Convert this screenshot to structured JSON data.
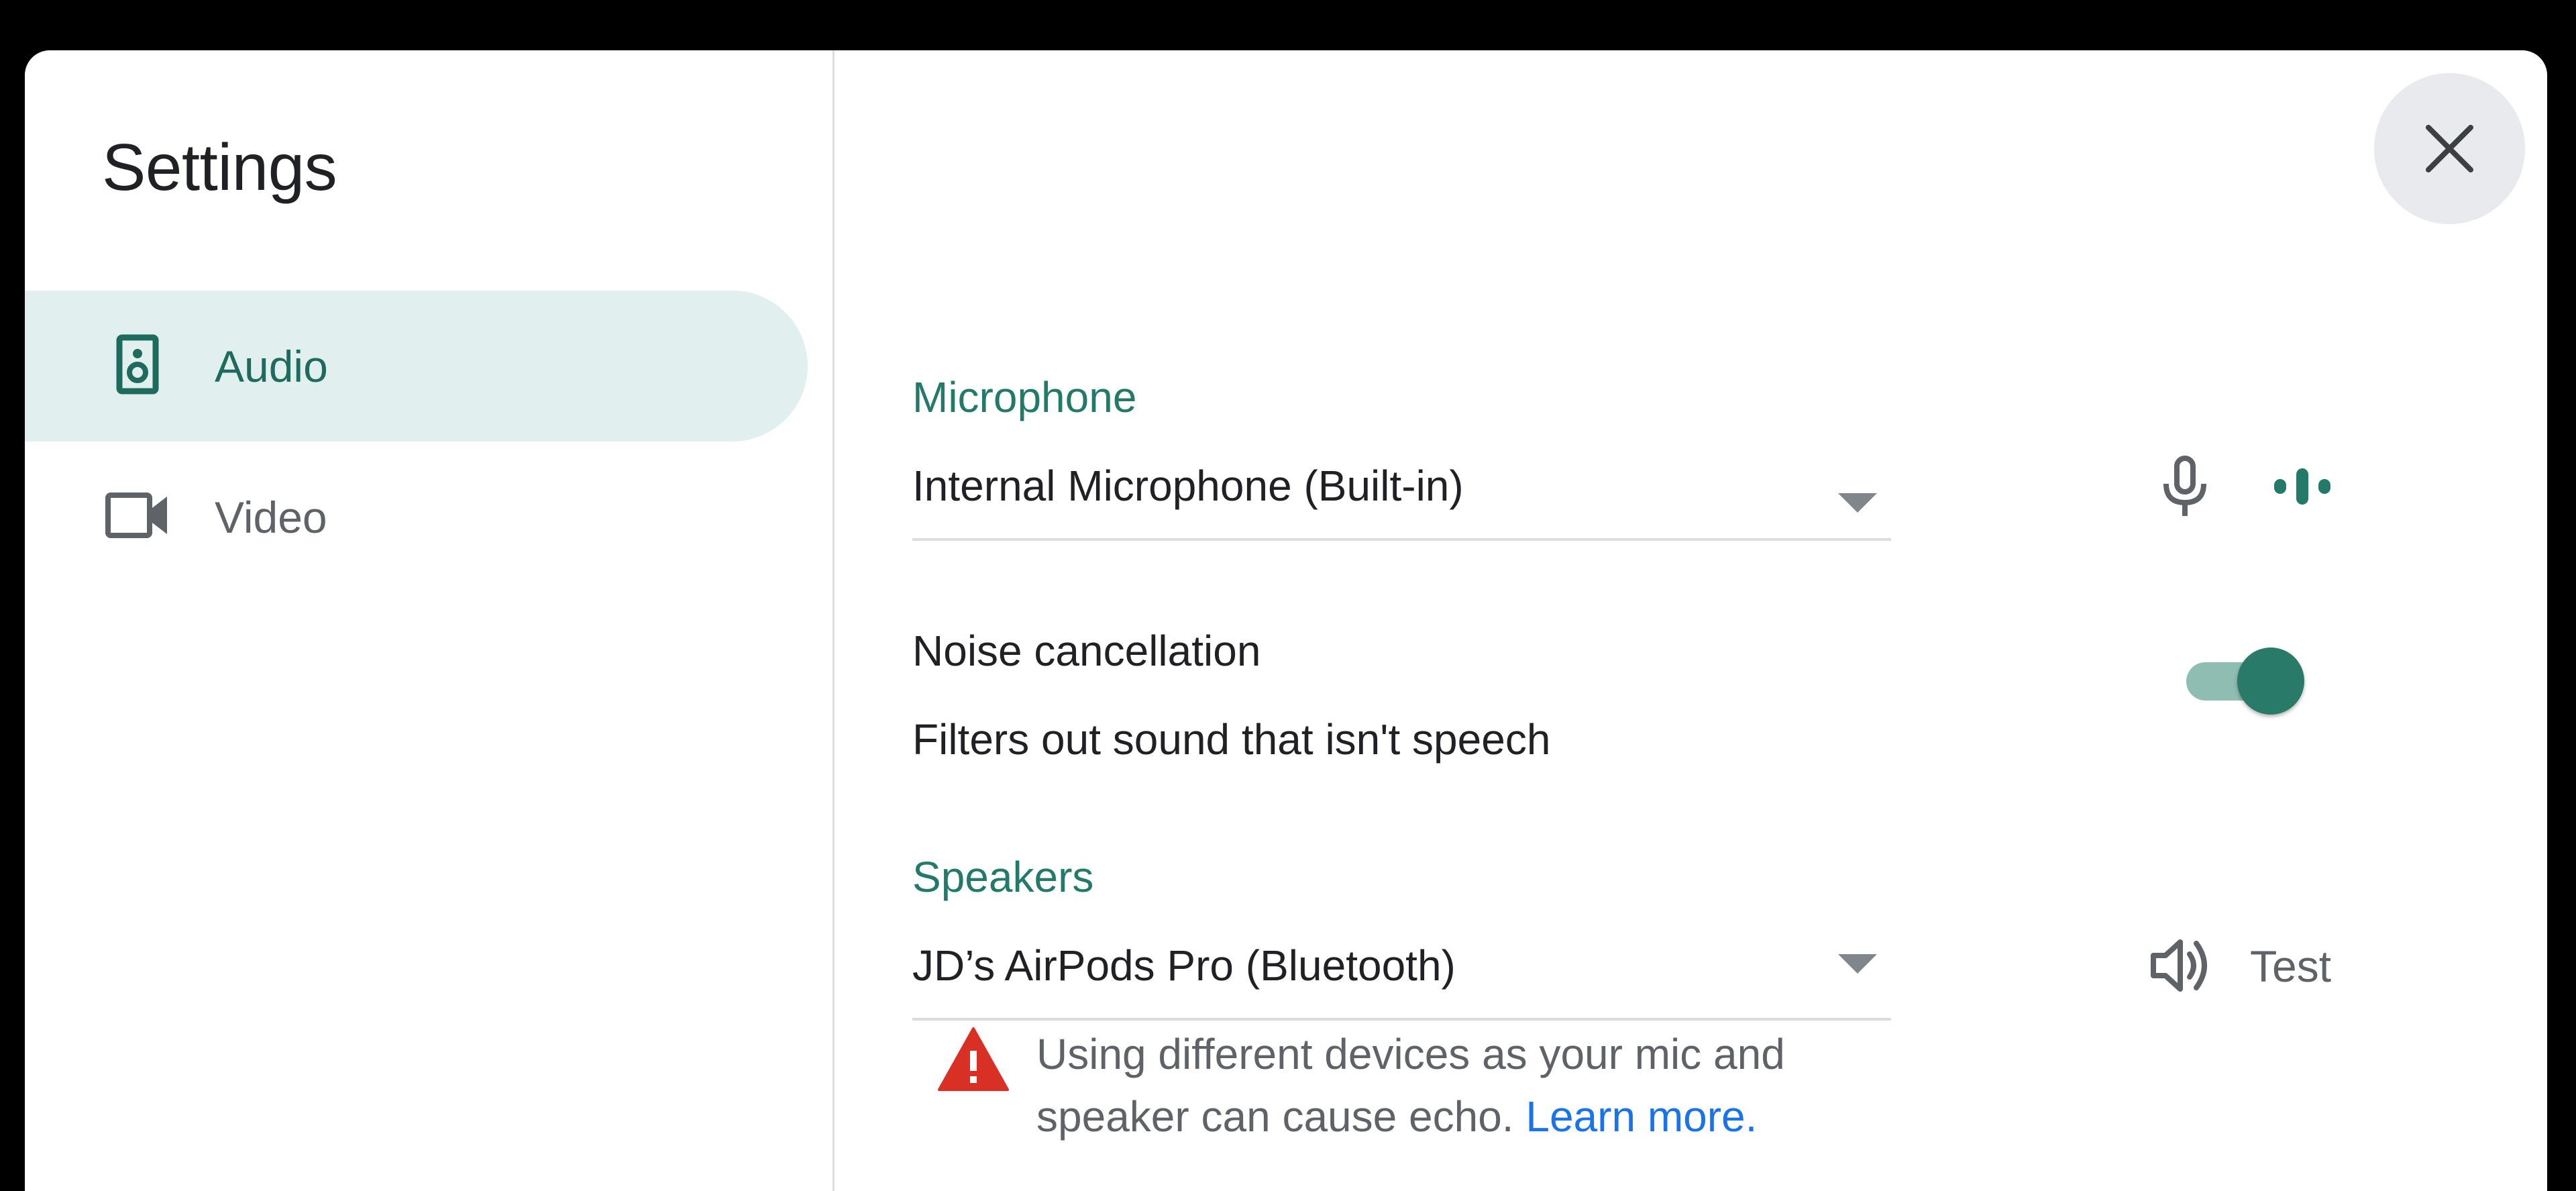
{
  "dialog": {
    "title": "Settings",
    "close_icon": "close-icon"
  },
  "sidebar": {
    "items": [
      {
        "label": "Audio",
        "icon": "speaker-icon",
        "active": true
      },
      {
        "label": "Video",
        "icon": "videocam-icon",
        "active": false
      }
    ]
  },
  "microphone": {
    "section_label": "Microphone",
    "selected": "Internal Microphone (Built-in)",
    "icons": [
      "microphone-icon",
      "audio-level-icon"
    ]
  },
  "noise_cancellation": {
    "title": "Noise cancellation",
    "description": "Filters out sound that isn't speech",
    "enabled": true
  },
  "speakers": {
    "section_label": "Speakers",
    "selected": "JD’s AirPods Pro (Bluetooth)",
    "test_label": "Test",
    "test_icon": "volume-icon"
  },
  "warning": {
    "icon": "warning-icon",
    "text": "Using different devices as your mic and speaker can cause echo. ",
    "link": "Learn more."
  },
  "colors": {
    "accent": "#237a68",
    "active_nav_bg": "#e1efee",
    "toggle_thumb": "#2a7a69",
    "toggle_track": "#8fbdb2",
    "warning": "#d93025",
    "link": "#1a73e8"
  }
}
